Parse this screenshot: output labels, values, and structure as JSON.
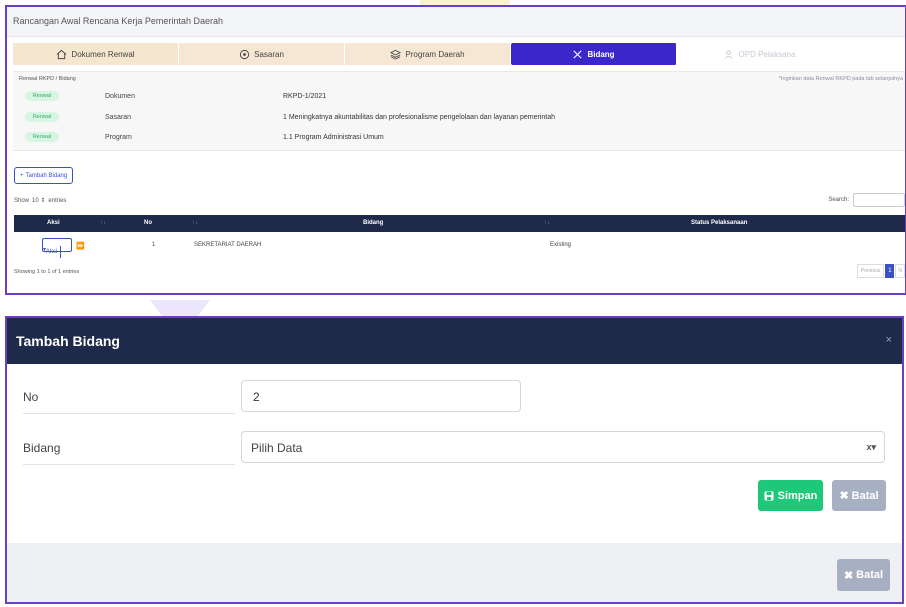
{
  "page": {
    "title": "Rancangan Awal Rencana Kerja Pemerintah Daerah"
  },
  "steps": [
    {
      "label": "Dokumen Renwal",
      "icon": "home-icon",
      "state": "done"
    },
    {
      "label": "Sasaran",
      "icon": "target-icon",
      "state": "done"
    },
    {
      "label": "Program Daerah",
      "icon": "layers-icon",
      "state": "done"
    },
    {
      "label": "Bidang",
      "icon": "tools-icon",
      "state": "active"
    },
    {
      "label": "OPD Pelaksana",
      "icon": "users-icon",
      "state": "disabled"
    }
  ],
  "breadcrumb": "Renwal RKPD / Bidang",
  "breadcrumb_note": "*Inginkan data Renwal RKPD pada tab selanjutnya",
  "info": [
    {
      "badge": "Renwal",
      "key": "Dokumen",
      "value": "RKPD-1/2021"
    },
    {
      "badge": "Renwal",
      "key": "Sasaran",
      "value": "1 Meningkatnya akuntabilitas dan profesionalisme pengelolaan dan layanan pemerintah"
    },
    {
      "badge": "Renwal",
      "key": "Program",
      "value": "1.1 Program Administrasi Umum"
    }
  ],
  "add_button": "Tambah Bidang",
  "show": {
    "prefix": "Show",
    "value": "10",
    "suffix": "entries"
  },
  "search_label": "Search:",
  "table": {
    "headers": {
      "aksi": "Aksi",
      "no": "No",
      "bidang": "Bidang",
      "status": "Status Pelaksanaan"
    },
    "sort_icon": "↑↓",
    "rows": [
      {
        "aksi": "Aksi",
        "no": "1",
        "bidang": "SEKRETARIAT DAERAH",
        "status": "Existing"
      }
    ]
  },
  "showing": "Showing 1 to 1 of 1 entries",
  "pager": {
    "prev": "Previous",
    "page": "1",
    "next": "N"
  },
  "modal": {
    "title": "Tambah Bidang",
    "no_label": "No",
    "no_value": "2",
    "bidang_label": "Bidang",
    "bidang_placeholder": "Pilih Data",
    "select_tools": "x▾",
    "save": "Simpan",
    "cancel": "Batal",
    "footer_cancel": "Batal",
    "close": "×"
  },
  "colors": {
    "primary": "#3b27c9",
    "header_dark": "#1e2a49",
    "success": "#1ec878",
    "muted_btn": "#a7b0c2",
    "frame": "#6a3fc4"
  }
}
